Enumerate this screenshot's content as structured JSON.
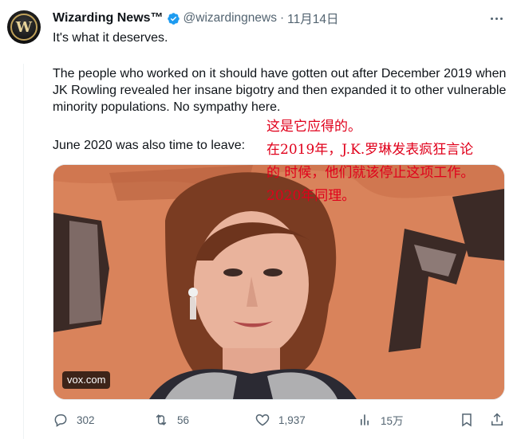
{
  "tweet": {
    "author_name": "Wizarding News™",
    "handle": "@wizardingnews",
    "separator": "·",
    "date": "11月14日",
    "text_line1": "It's what it deserves.",
    "text_paragraph2": "The people who worked on it should have gotten out after December 2019 when JK Rowling revealed her insane bigotry and then expanded it to other vulnerable minority populations. No sympathy here.",
    "text_line3": "June 2020 was also time to leave:",
    "media_source": "vox.com"
  },
  "overlay": {
    "line1": "这是它应得的。",
    "line2": "在2019年，J.K.罗琳发表疯狂言论",
    "line3": "的 时候，他们就该停止这项工作。",
    "line4": "2020年同理。",
    "color": "#e0001b"
  },
  "actions": {
    "reply_count": "302",
    "retweet_count": "56",
    "like_count": "1,937",
    "views_count": "15万"
  },
  "colors": {
    "verified": "#1d9bf0",
    "secondary_text": "#536471",
    "primary_text": "#0f1419"
  },
  "icons": [
    "avatar-crest",
    "verified-badge-icon",
    "more-icon",
    "reply-icon",
    "retweet-icon",
    "like-icon",
    "views-icon",
    "bookmark-icon",
    "share-icon"
  ]
}
